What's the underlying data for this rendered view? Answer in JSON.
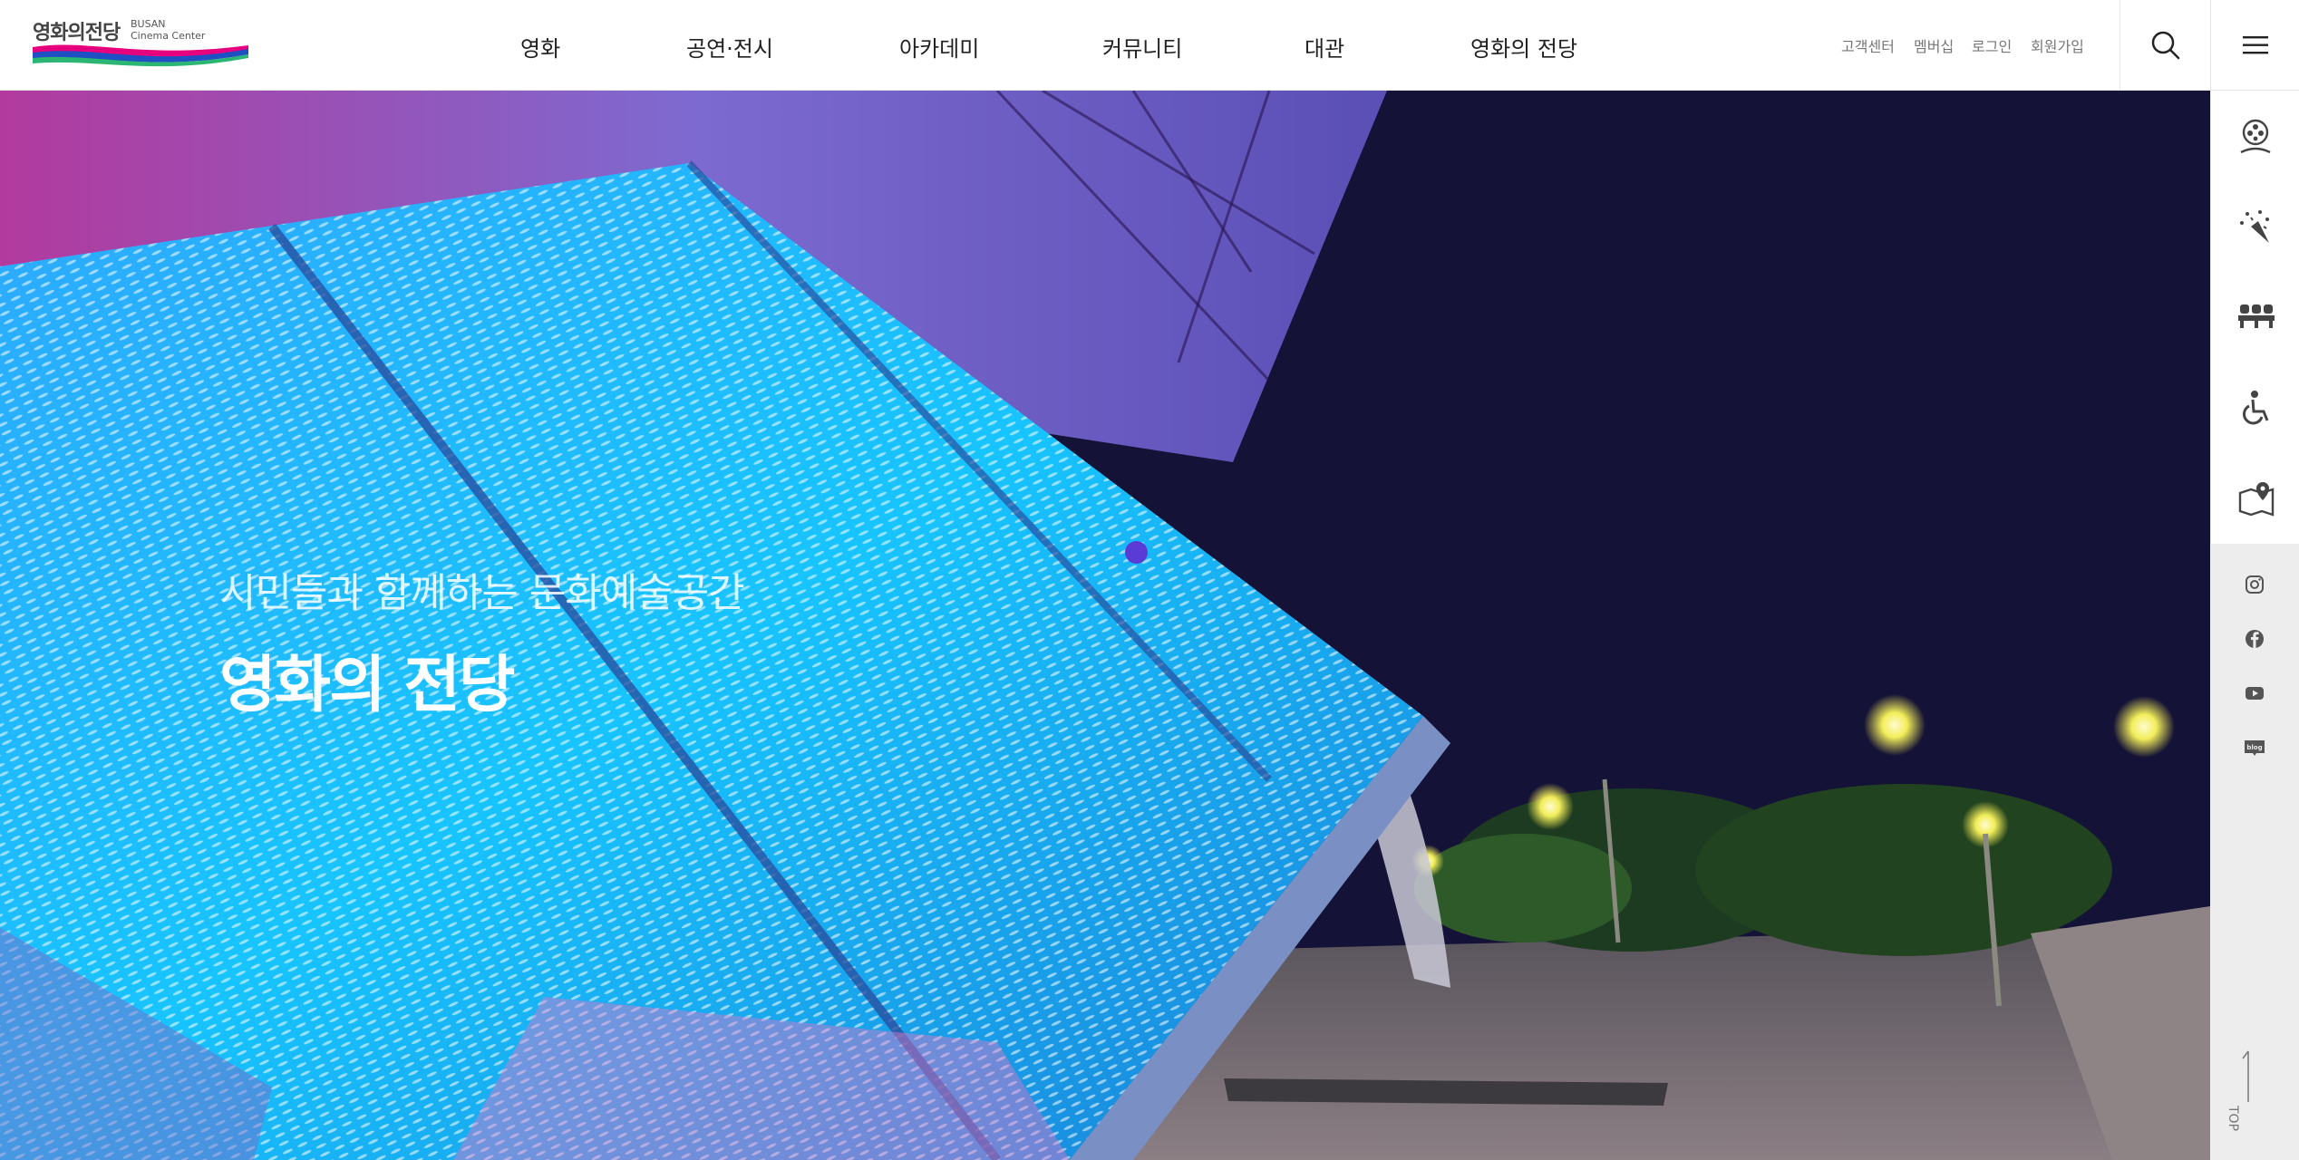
{
  "logo": {
    "name_ko": "영화의전당",
    "name_en_line1": "BUSAN",
    "name_en_line2": "Cinema Center"
  },
  "nav": [
    {
      "label": "영화"
    },
    {
      "label": "공연·전시"
    },
    {
      "label": "아카데미"
    },
    {
      "label": "커뮤니티"
    },
    {
      "label": "대관"
    },
    {
      "label": "영화의 전당"
    }
  ],
  "util": [
    {
      "label": "고객센터"
    },
    {
      "label": "멤버십"
    },
    {
      "label": "로그인"
    },
    {
      "label": "회원가입"
    }
  ],
  "hero": {
    "subtitle": "시민들과 함께하는 문화예술공간",
    "title": "영화의 전당"
  },
  "quick_menu_icons": [
    "film-reel-icon",
    "fireworks-icon",
    "seats-icon",
    "wheelchair-icon",
    "map-pin-icon"
  ],
  "sns_icons": [
    "instagram-icon",
    "facebook-icon",
    "youtube-icon",
    "blog-icon"
  ],
  "sns_blog_label": "blog",
  "top_button": {
    "label": "TOP"
  },
  "colors": {
    "brand_pink": "#e6007e",
    "brand_blue": "#1e4fc3",
    "brand_green": "#2bb673",
    "accent_dot": "#5b3bd6",
    "sidebar_bg": "#ededed"
  }
}
